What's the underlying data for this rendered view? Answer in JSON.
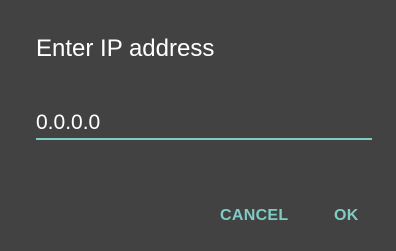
{
  "dialog": {
    "title": "Enter IP address",
    "input_value": "0.0.0.0",
    "accent_color": "#80cbc4",
    "background_color": "#424242",
    "buttons": {
      "cancel_label": "CANCEL",
      "ok_label": "OK"
    }
  }
}
